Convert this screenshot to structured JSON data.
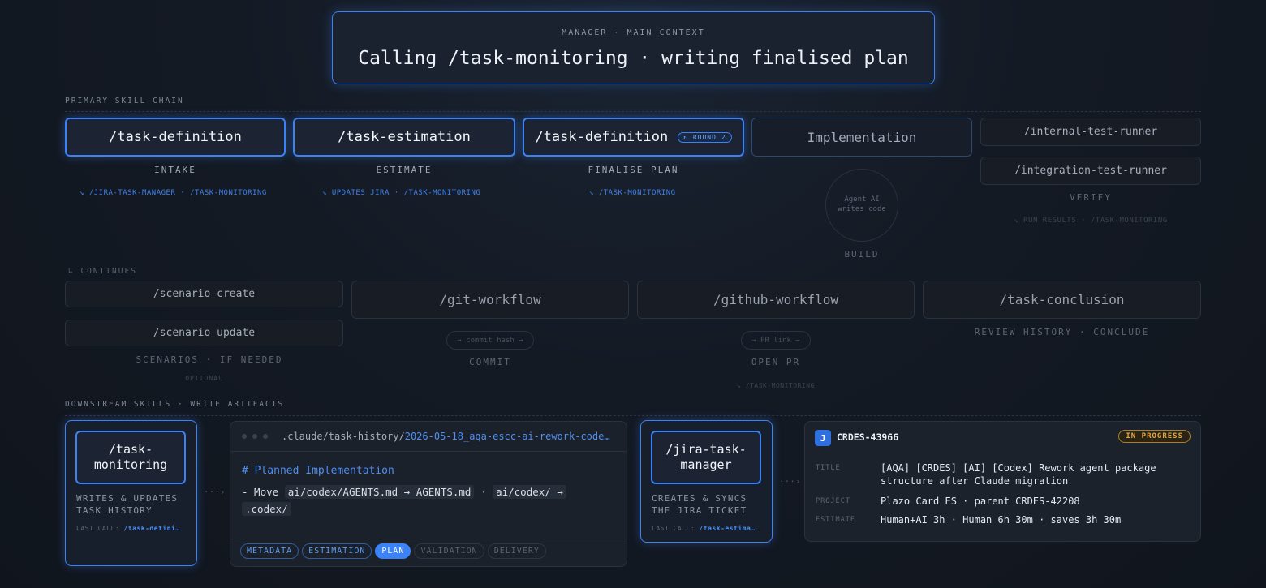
{
  "manager": {
    "label": "MANAGER · MAIN CONTEXT",
    "title": "Calling /task-monitoring · writing finalised plan"
  },
  "primary_chain": {
    "label": "PRIMARY SKILL CHAIN",
    "steps": [
      {
        "skill": "/task-definition",
        "stage": "INTAKE",
        "sub": "↘ /JIRA-TASK-MANAGER · /TASK-MONITORING"
      },
      {
        "skill": "/task-estimation",
        "stage": "ESTIMATE",
        "sub": "↘ UPDATES JIRA · /TASK-MONITORING"
      },
      {
        "skill": "/task-definition",
        "badge": "↻ ROUND 2",
        "stage": "FINALISE PLAN",
        "sub": "↘ /TASK-MONITORING"
      },
      {
        "skill": "Implementation",
        "circle_line1": "Agent AI",
        "circle_line2": "writes code",
        "stage": "BUILD"
      },
      {
        "skill": "/internal-test-runner",
        "skill2": "/integration-test-runner",
        "stage": "VERIFY",
        "sub": "↘ RUN RESULTS · /TASK-MONITORING"
      }
    ]
  },
  "continues": {
    "label": "↳ CONTINUES",
    "steps": [
      {
        "skill": "/scenario-create",
        "skill2": "/scenario-update",
        "stage": "SCENARIOS · IF NEEDED",
        "sub": "OPTIONAL"
      },
      {
        "skill": "/git-workflow",
        "pill": "→ commit hash →",
        "stage": "COMMIT"
      },
      {
        "skill": "/github-workflow",
        "pill": "→ PR link →",
        "stage": "OPEN PR",
        "sub": "↘ /TASK-MONITORING"
      },
      {
        "skill": "/task-conclusion",
        "stage": "REVIEW HISTORY · CONCLUDE"
      }
    ]
  },
  "downstream": {
    "label": "DOWNSTREAM SKILLS · WRITE ARTIFACTS",
    "monitoring": {
      "skill": "/task-\nmonitoring",
      "desc": "WRITES & UPDATES\nTASK HISTORY",
      "last_prefix": "LAST CALL:",
      "last_value": "/task-defini…"
    },
    "arrow1": "···›",
    "file": {
      "path_prefix": ".claude/task-history/",
      "path_highlight": "2026-05-18_aqa-escc-ai-rework-code…",
      "heading": "# Planned Implementation",
      "line_prefix": "- Move",
      "code1": "ai/codex/AGENTS.md → AGENTS.md",
      "sep": "·",
      "code2": "ai/codex/ →",
      "code3": ".codex/",
      "tabs": [
        "METADATA",
        "ESTIMATION",
        "PLAN",
        "VALIDATION",
        "DELIVERY"
      ]
    },
    "jira_manager": {
      "skill": "/jira-task-\nmanager",
      "desc": "CREATES & SYNCS\nTHE JIRA TICKET",
      "last_prefix": "LAST CALL:",
      "last_value": "/task-estima…"
    },
    "arrow2": "···›",
    "ticket": {
      "logo": "J",
      "key": "CRDES-43966",
      "status": "IN PROGRESS",
      "title_label": "TITLE",
      "title": "[AQA] [CRDES] [AI] [Codex] Rework agent package structure after Claude migration",
      "project_label": "PROJECT",
      "project": "Plazo Card ES · parent CRDES-42208",
      "estimate_label": "ESTIMATE",
      "estimate": "Human+AI 3h · Human 6h 30m · saves 3h 30m"
    }
  }
}
